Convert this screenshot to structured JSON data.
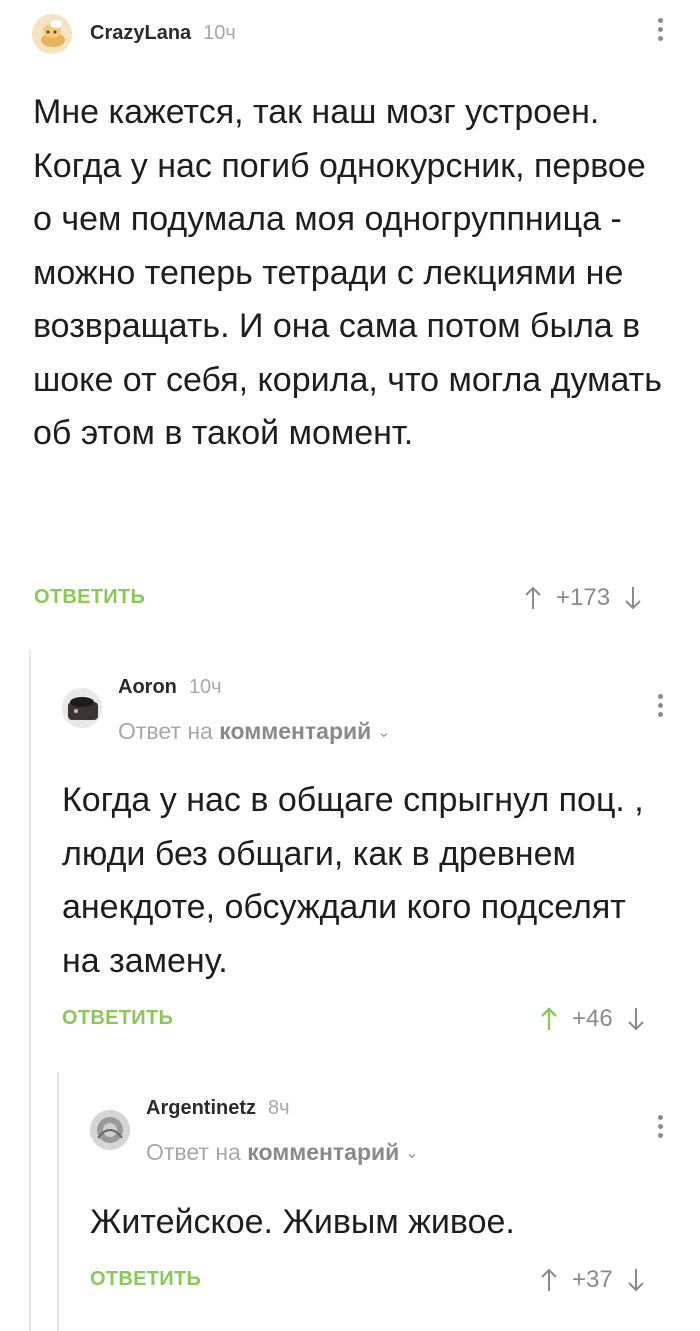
{
  "comments": [
    {
      "author": "CrazyLana",
      "time": "10ч",
      "text": "Мне кажется, так наш мозг устроен. Когда у нас погиб однокурсник, первое о чем подумала моя одногруппница - можно теперь тетради с лекциями не возвращать. И она сама потом была в шоке от себя, корила, что могла думать об этом в такой момент.",
      "reply_label": "ОТВЕТИТЬ",
      "score": "+173",
      "upvoted": false
    },
    {
      "author": "Aoron",
      "time": "10ч",
      "reply_prefix": "Ответ на",
      "reply_target": "комментарий",
      "text": "Когда у нас в общаге спрыгнул поц. , люди без общаги, как в древнем анекдоте, обсуждали кого подселят на замену.",
      "reply_label": "ОТВЕТИТЬ",
      "score": "+46",
      "upvoted": true
    },
    {
      "author": "Argentinetz",
      "time": "8ч",
      "reply_prefix": "Ответ на",
      "reply_target": "комментарий",
      "text": "Житейское. Живым живое.",
      "reply_label": "ОТВЕТИТЬ",
      "score": "+37",
      "upvoted": false
    }
  ],
  "colors": {
    "accent_green": "#8ac858",
    "muted": "#a8a8a8",
    "thread_line": "#e6e6e6"
  },
  "icons": [
    "more-vertical-icon",
    "upvote-arrow-icon",
    "downvote-arrow-icon",
    "chevron-down-icon"
  ]
}
